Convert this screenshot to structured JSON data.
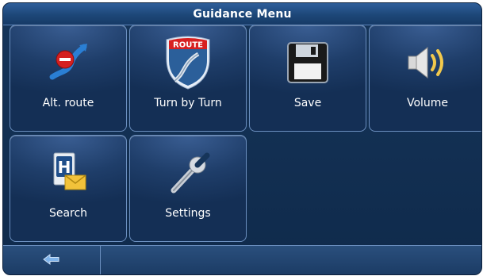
{
  "title": "Guidance Menu",
  "tiles": [
    {
      "label": "Alt. route",
      "icon": "alt-route-icon"
    },
    {
      "label": "Turn by Turn",
      "icon": "route-shield-icon",
      "badge": "ROUTE"
    },
    {
      "label": "Save",
      "icon": "floppy-disk-icon"
    },
    {
      "label": "Volume",
      "icon": "speaker-icon"
    },
    {
      "label": "Search",
      "icon": "hotel-search-icon",
      "badge": "H"
    },
    {
      "label": "Settings",
      "icon": "wrench-icon"
    }
  ],
  "bottom_bar": {
    "back_icon": "back-arrow-icon"
  },
  "colors": {
    "background": "#0f2a4b",
    "tile_border": "#6b8fbf",
    "title_bar": "#1d4778",
    "text": "#ffffff"
  }
}
